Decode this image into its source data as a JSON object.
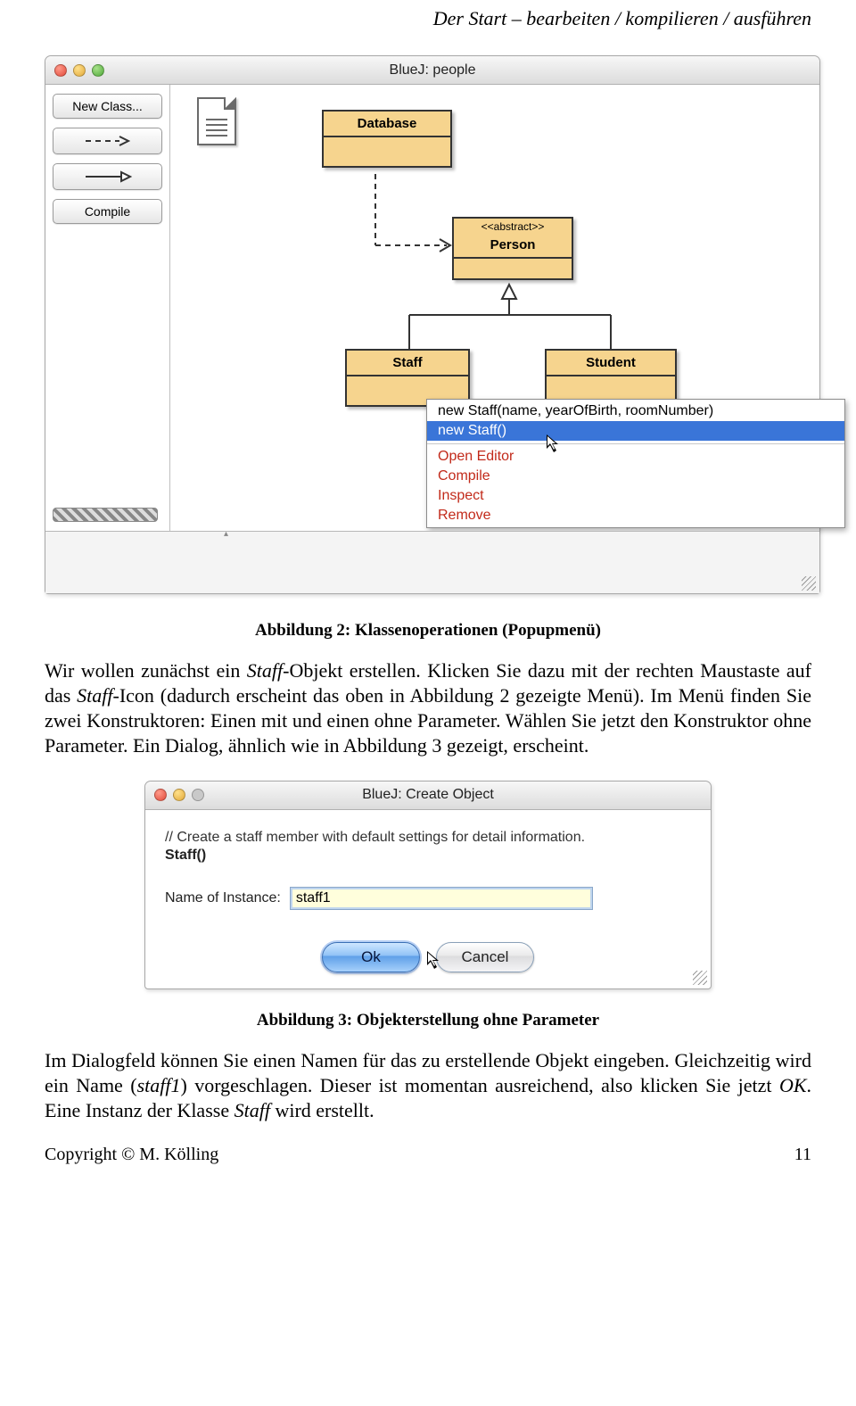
{
  "header": "Der Start – bearbeiten / kompilieren / ausführen",
  "fig1": {
    "window_title": "BlueJ:  people",
    "sidebar": {
      "new_class": "New Class...",
      "compile": "Compile"
    },
    "classes": {
      "database": "Database",
      "person_stereo": "<<abstract>>",
      "person": "Person",
      "staff": "Staff",
      "student": "Student"
    },
    "menu": {
      "item1": "new Staff(name, yearOfBirth, roomNumber)",
      "item2": "new Staff()",
      "open_editor": "Open Editor",
      "compile": "Compile",
      "inspect": "Inspect",
      "remove": "Remove"
    },
    "caption": "Abbildung 2: Klassenoperationen (Popupmenü)"
  },
  "para1": {
    "s1a": "Wir wollen zunächst ein ",
    "s1b": "Staff",
    "s1c": "-Objekt erstellen. Klicken Sie dazu mit der rechten Maustaste auf das ",
    "s1d": "Staff",
    "s1e": "-Icon (dadurch erscheint das oben in Abbildung 2 gezeigte Menü). Im Menü finden Sie zwei Konstruktoren: Einen mit und einen ohne Parameter. Wählen Sie jetzt den Konstruktor ohne Parameter. Ein Dialog, ähnlich wie in Abbildung 3 gezeigt, erscheint."
  },
  "fig2": {
    "window_title": "BlueJ:  Create Object",
    "desc": "// Create a staff member with default settings for detail information.",
    "sig": "Staff()",
    "label": "Name of Instance:",
    "value": "staff1",
    "ok": "Ok",
    "cancel": "Cancel",
    "caption": "Abbildung 3: Objekterstellung ohne Parameter"
  },
  "para2": {
    "s1a": "Im Dialogfeld können Sie einen Namen für das zu erstellende Objekt eingeben. Gleichzeitig wird ein Name (",
    "s1b": "staff1",
    "s1c": ") vorgeschlagen. Dieser ist momentan ausreichend, also klicken Sie jetzt ",
    "s1d": "OK",
    "s1e": ". Eine Instanz der Klasse ",
    "s1f": "Staff",
    "s1g": " wird erstellt."
  },
  "footer": {
    "left": "Copyright © M. Kölling",
    "right": "11"
  }
}
